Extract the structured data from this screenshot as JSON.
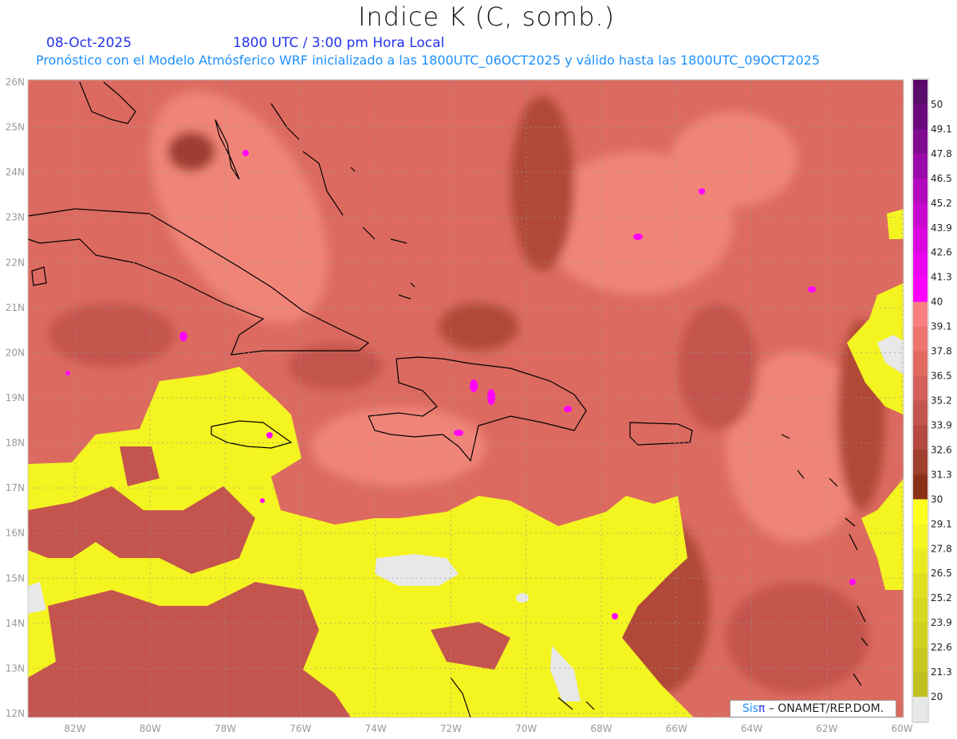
{
  "header": {
    "title": "Indice K (C, somb.)",
    "date": "08-Oct-2025",
    "time": "1800 UTC / 3:00 pm Hora Local",
    "subtitle": "Pronóstico con el Modelo Atmósferico WRF inicializado a las 1800UTC_06OCT2025 y válido hasta las  1800UTC_09OCT2025"
  },
  "map": {
    "lon_labels": [
      "82W",
      "80W",
      "78W",
      "76W",
      "74W",
      "72W",
      "70W",
      "68W",
      "66W",
      "64W",
      "62W",
      "60W"
    ],
    "lon_values": [
      -82,
      -80,
      -78,
      -76,
      -74,
      -72,
      -70,
      -68,
      -66,
      -64,
      -62,
      -60
    ],
    "lat_labels": [
      "26N",
      "25N",
      "24N",
      "23N",
      "22N",
      "21N",
      "20N",
      "19N",
      "18N",
      "17N",
      "16N",
      "15N",
      "14N",
      "13N",
      "12N"
    ],
    "lat_values": [
      26,
      25,
      24,
      23,
      22,
      21,
      20,
      19,
      18,
      17,
      16,
      15,
      14,
      13,
      12
    ],
    "colors": {
      "base": "#dc6a60",
      "dark": "#b04838",
      "light": "#f08478",
      "yellow": "#f4f420",
      "gray": "#e8e8e8",
      "coast": "#000000",
      "magenta": "#ff00ff"
    }
  },
  "colorbar": {
    "labels": [
      "50",
      "49.1",
      "47.8",
      "46.5",
      "45.2",
      "43.9",
      "42.6",
      "41.3",
      "40",
      "39.1",
      "37.8",
      "36.5",
      "35.2",
      "33.9",
      "32.6",
      "31.3",
      "30",
      "29.1",
      "27.8",
      "26.5",
      "25.2",
      "23.9",
      "22.6",
      "21.3",
      "20"
    ],
    "colors": [
      "#5a0a6a",
      "#6b0a7c",
      "#800a90",
      "#9a0aa8",
      "#b20abe",
      "#c808d0",
      "#dc05e0",
      "#ec02f0",
      "#ff00ff",
      "#f88080",
      "#ee7470",
      "#e06a62",
      "#d2605a",
      "#c4554e",
      "#b44a42",
      "#a03e30",
      "#8a3018",
      "#ffff20",
      "#f5f520",
      "#eaea20",
      "#e0e020",
      "#d8d820",
      "#d0d020",
      "#c8c820",
      "#c0c020",
      "#e8e8e8"
    ]
  },
  "credit": {
    "brand_a": "Sis",
    "brand_b": "π",
    "text": "– ONAMET/REP.DOM."
  }
}
